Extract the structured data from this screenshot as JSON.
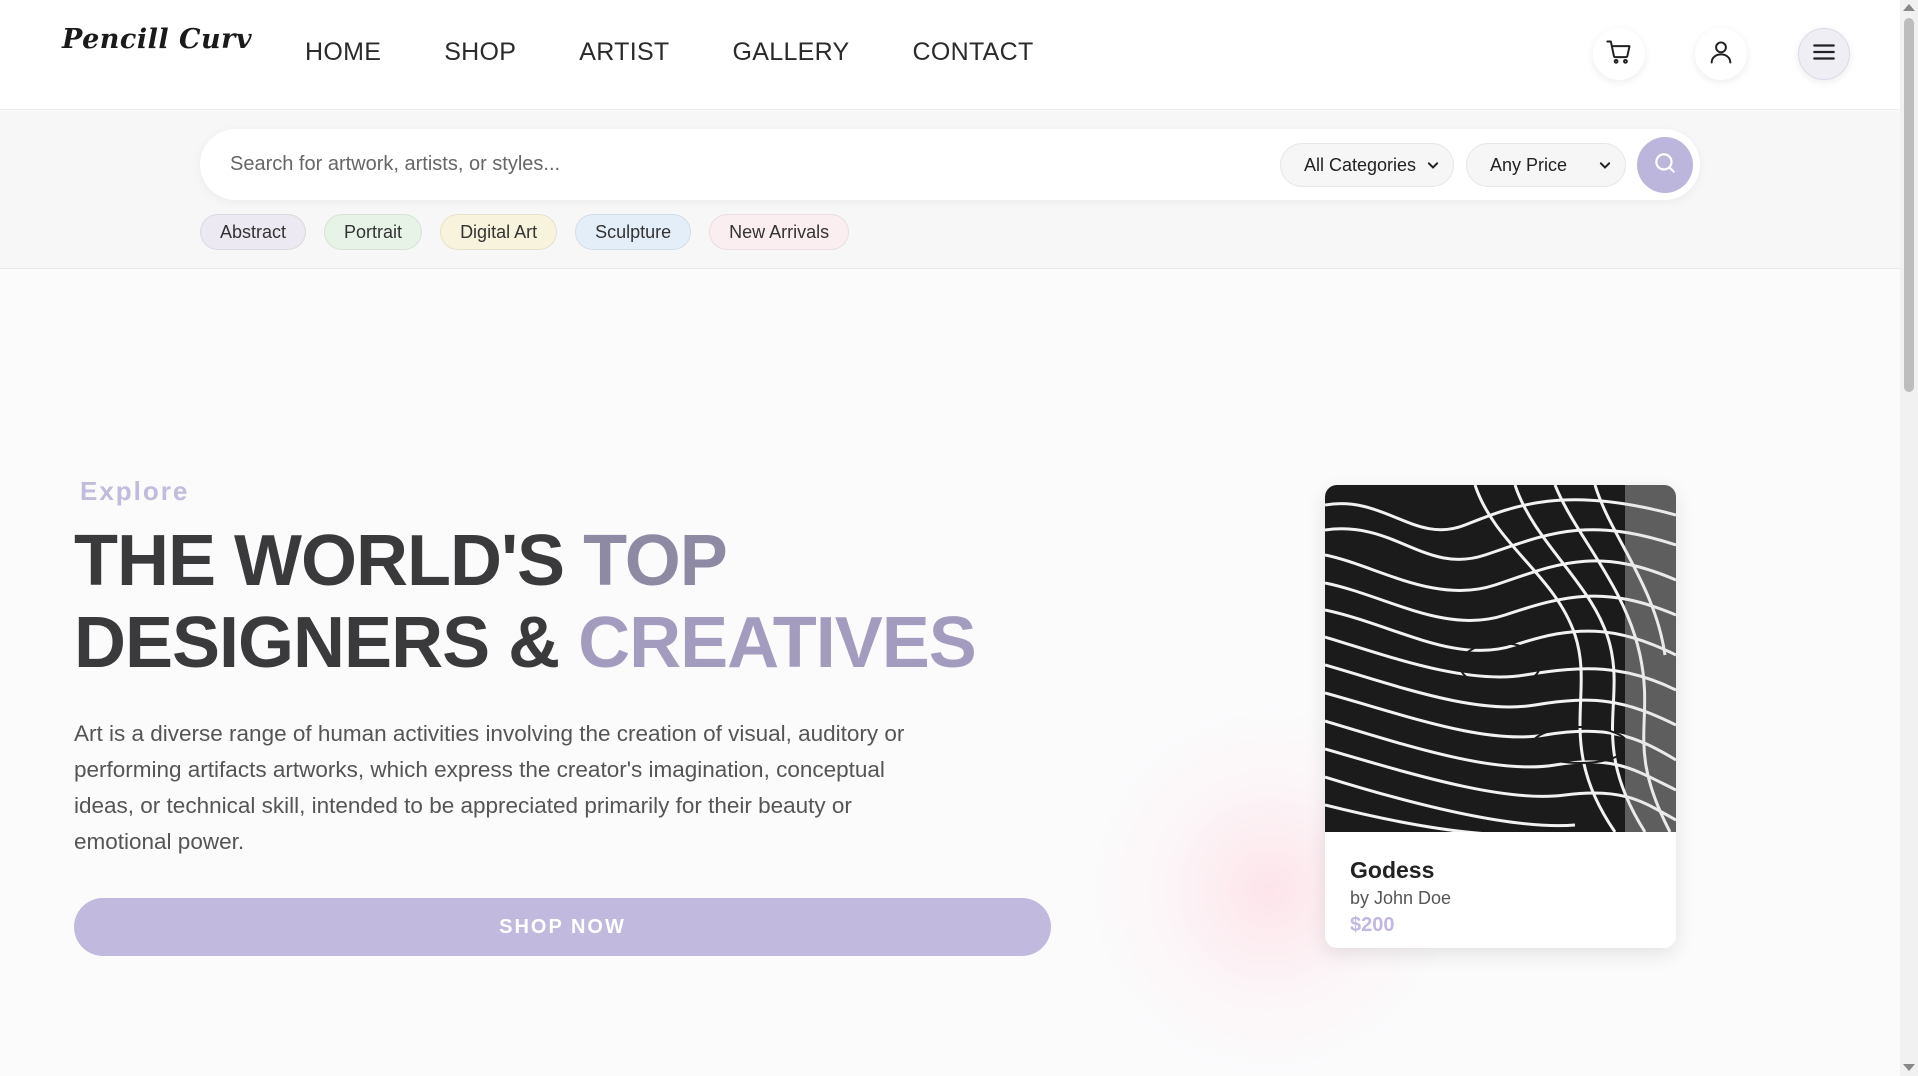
{
  "brand": {
    "logo": "Pencill Curv"
  },
  "nav": {
    "items": [
      "HOME",
      "SHOP",
      "ARTIST",
      "GALLERY",
      "CONTACT"
    ]
  },
  "header_icons": [
    "cart-icon",
    "user-icon",
    "menu-icon"
  ],
  "search": {
    "placeholder": "Search for artwork, artists, or styles...",
    "value": "",
    "category_selected": "All Categories",
    "price_selected": "Any Price"
  },
  "chips": [
    {
      "label": "Abstract",
      "color": "#ece9f3"
    },
    {
      "label": "Portrait",
      "color": "#e8f3e7"
    },
    {
      "label": "Digital Art",
      "color": "#f7f3dc"
    },
    {
      "label": "Sculpture",
      "color": "#e4eef8"
    },
    {
      "label": "New Arrivals",
      "color": "#fbeef0"
    }
  ],
  "hero": {
    "eyebrow": "Explore",
    "headline_line1_a": "THE WORLD'S ",
    "headline_line1_b": "TOP",
    "headline_line2_a": "DESIGNERS & ",
    "headline_line2_b": "CREATIVES",
    "description": "Art is a diverse range of human activities involving the creation of visual, auditory or performing artifacts artworks, which express the creator's imagination, conceptual ideas, or technical skill, intended to be appreciated primarily for their beauty or emotional power.",
    "cta": "SHOP NOW"
  },
  "featured": {
    "title": "Godess",
    "artist": "by John Doe",
    "price": "$200"
  },
  "colors": {
    "accent": "#c1b9de",
    "price": "#c2b7e3",
    "heading": "#3a3a3c"
  }
}
